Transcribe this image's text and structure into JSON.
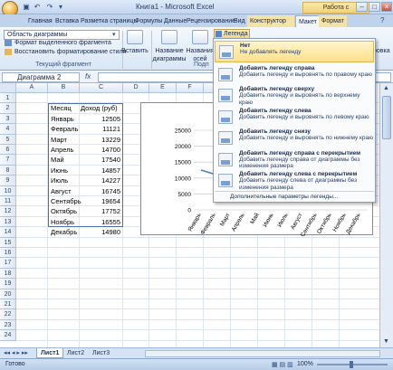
{
  "window": {
    "title": "Книга1 - Microsoft Excel",
    "context_title": "Работа с диаграммами"
  },
  "tabs": [
    "Главная",
    "Вставка",
    "Разметка страницы",
    "Формулы",
    "Данные",
    "Рецензирование",
    "Вид",
    "Конструктор",
    "Макет",
    "Формат"
  ],
  "ribbon": {
    "area_value": "Область диаграммы",
    "format_selection": "Формат выделенного фрагмента",
    "reset_style": "Восстановить форматирование стиля",
    "group_current": "Текущий фрагмент",
    "insert": "Вставить",
    "chart_titles": [
      "Название",
      "диаграммы"
    ],
    "axis_titles": [
      "Названия",
      "осей"
    ],
    "group_labels": "Подп",
    "legend_button": "Легенда",
    "right_partial": "ровка"
  },
  "formula_bar": {
    "name_box": "Диаграмма 2",
    "fx": "fx"
  },
  "columns": [
    "A",
    "B",
    "C",
    "D",
    "E",
    "F",
    "G",
    "H",
    "I",
    "J",
    "K"
  ],
  "rows": [
    "1",
    "2",
    "3",
    "4",
    "5",
    "6",
    "7",
    "8",
    "9",
    "10",
    "11",
    "12",
    "13",
    "14",
    "15",
    "16",
    "17",
    "18",
    "19",
    "20",
    "21",
    "22",
    "23",
    "24"
  ],
  "table": {
    "headers": [
      "Месяц",
      "Доход (руб)"
    ],
    "months": [
      "Январь",
      "Февраль",
      "Март",
      "Апрель",
      "Май",
      "Июнь",
      "Июль",
      "Август",
      "Сентябрь",
      "Октябрь",
      "Ноябрь",
      "Декабрь"
    ],
    "values": [
      "12505",
      "11121",
      "13229",
      "14700",
      "17540",
      "14857",
      "14227",
      "16745",
      "19654",
      "17752",
      "16555",
      "14980"
    ]
  },
  "chart_data": {
    "type": "line",
    "categories": [
      "Январь",
      "Февраль",
      "Март",
      "Апрель",
      "Май",
      "Июнь",
      "Июль",
      "Август",
      "Сентябрь",
      "Октябрь",
      "Ноябрь",
      "Декабрь"
    ],
    "series": [
      {
        "name": "Доход (руб)",
        "values": [
          12505,
          11121,
          13229,
          14700,
          17540,
          14857,
          14227,
          16745,
          19654,
          17752,
          16555,
          14980
        ]
      }
    ],
    "y_ticks": [
      "25000",
      "20000",
      "15000",
      "10000",
      "5000",
      "0"
    ],
    "ylim": [
      0,
      25000
    ],
    "legend_partial": "(руб",
    "line_color": "#4a7ebb"
  },
  "legend_menu": {
    "items": [
      {
        "title": "Нет",
        "desc": "Не добавлять легенду"
      },
      {
        "title": "Добавить легенду справа",
        "desc": "Добавить легенду и выровнять по правому краю"
      },
      {
        "title": "Добавить легенду сверху",
        "desc": "Добавить легенду и выровнять по верхнему краю"
      },
      {
        "title": "Добавить легенду слева",
        "desc": "Добавить легенду и выровнять по левому краю"
      },
      {
        "title": "Добавить легенду снизу",
        "desc": "Добавить легенду и выровнять по нижнему краю"
      },
      {
        "title": "Добавить легенду справа с перекрытием",
        "desc": "Добавить легенду справа от диаграммы без изменения размера"
      },
      {
        "title": "Добавить легенду слева с перекрытием",
        "desc": "Добавить легенду слева от диаграммы без изменения размера"
      }
    ],
    "more": "Дополнительные параметры легенды..."
  },
  "sheet_tabs": [
    "Лист1",
    "Лист2",
    "Лист3"
  ],
  "status": {
    "ready": "Готово",
    "zoom": "100%"
  }
}
